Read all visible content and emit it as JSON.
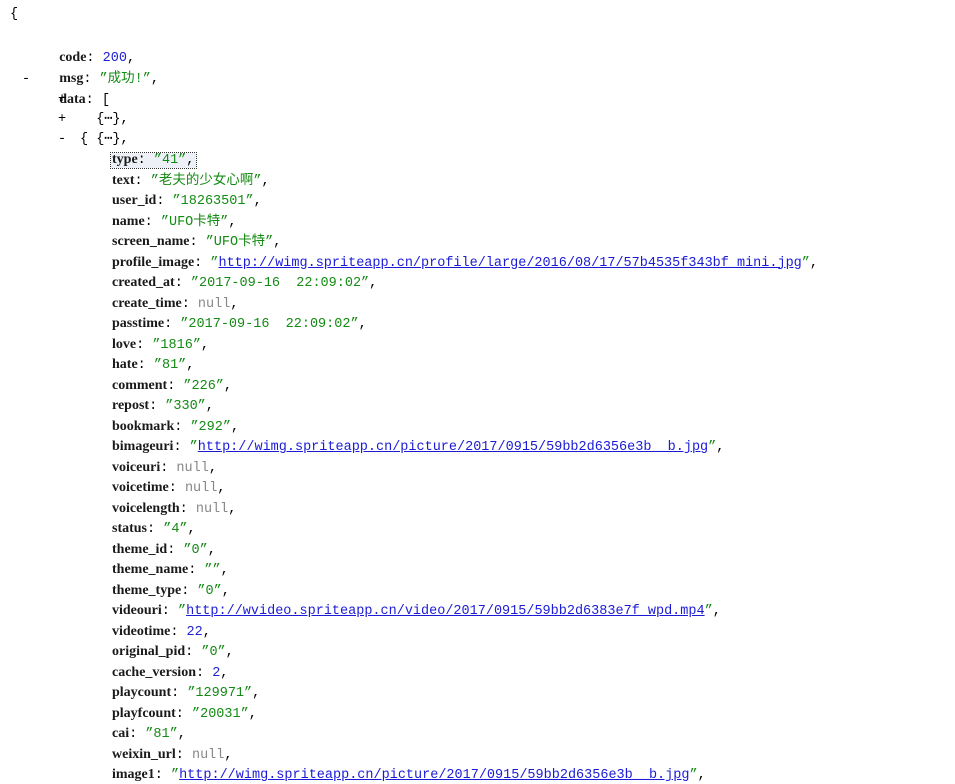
{
  "root_open": "{",
  "top": {
    "code": {
      "key": "code",
      "value": "200"
    },
    "msg": {
      "key": "msg",
      "value": "”成功!”"
    },
    "data": {
      "key": "data",
      "open": "["
    }
  },
  "toggles": {
    "collapse": "-",
    "expand": "+"
  },
  "collapsed_items": [
    {
      "text": "{⋯}",
      "comma": ","
    },
    {
      "text": "{⋯}",
      "comma": ","
    }
  ],
  "expanded_open": "{",
  "fields": [
    {
      "key": "type",
      "value": "”41”",
      "kind": "str",
      "selected": true
    },
    {
      "key": "text",
      "value": "”老夫的少女心啊”",
      "kind": "str"
    },
    {
      "key": "user_id",
      "value": "”18263501”",
      "kind": "str"
    },
    {
      "key": "name",
      "value": "”UFO卡特”",
      "kind": "str"
    },
    {
      "key": "screen_name",
      "value": "”UFO卡特”",
      "kind": "str"
    },
    {
      "key": "profile_image",
      "value": "http://wimg.spriteapp.cn/profile/large/2016/08/17/57b4535f343bf_mini.jpg",
      "kind": "link"
    },
    {
      "key": "created_at",
      "value": "”2017-09-16  22:09:02”",
      "kind": "str"
    },
    {
      "key": "create_time",
      "value": "null",
      "kind": "nul"
    },
    {
      "key": "passtime",
      "value": "”2017-09-16  22:09:02”",
      "kind": "str"
    },
    {
      "key": "love",
      "value": "”1816”",
      "kind": "str"
    },
    {
      "key": "hate",
      "value": "”81”",
      "kind": "str"
    },
    {
      "key": "comment",
      "value": "”226”",
      "kind": "str"
    },
    {
      "key": "repost",
      "value": "”330”",
      "kind": "str"
    },
    {
      "key": "bookmark",
      "value": "”292”",
      "kind": "str"
    },
    {
      "key": "bimageuri",
      "value": "http://wimg.spriteapp.cn/picture/2017/0915/59bb2d6356e3b__b.jpg",
      "kind": "link"
    },
    {
      "key": "voiceuri",
      "value": "null",
      "kind": "nul"
    },
    {
      "key": "voicetime",
      "value": "null",
      "kind": "nul"
    },
    {
      "key": "voicelength",
      "value": "null",
      "kind": "nul"
    },
    {
      "key": "status",
      "value": "”4”",
      "kind": "str"
    },
    {
      "key": "theme_id",
      "value": "”0”",
      "kind": "str"
    },
    {
      "key": "theme_name",
      "value": "””",
      "kind": "str"
    },
    {
      "key": "theme_type",
      "value": "”0”",
      "kind": "str"
    },
    {
      "key": "videouri",
      "value": "http://wvideo.spriteapp.cn/video/2017/0915/59bb2d6383e7f_wpd.mp4",
      "kind": "link"
    },
    {
      "key": "videotime",
      "value": "22",
      "kind": "num"
    },
    {
      "key": "original_pid",
      "value": "”0”",
      "kind": "str"
    },
    {
      "key": "cache_version",
      "value": "2",
      "kind": "num"
    },
    {
      "key": "playcount",
      "value": "”129971”",
      "kind": "str"
    },
    {
      "key": "playfcount",
      "value": "”20031”",
      "kind": "str"
    },
    {
      "key": "cai",
      "value": "”81”",
      "kind": "str"
    },
    {
      "key": "weixin_url",
      "value": "null",
      "kind": "nul"
    },
    {
      "key": "image1",
      "value": "http://wimg.spriteapp.cn/picture/2017/0915/59bb2d6356e3b__b.jpg",
      "kind": "link"
    }
  ],
  "colors": {
    "string": "#138a13",
    "number": "#2222cc",
    "null": "#888888",
    "link": "#1b1bd6"
  }
}
